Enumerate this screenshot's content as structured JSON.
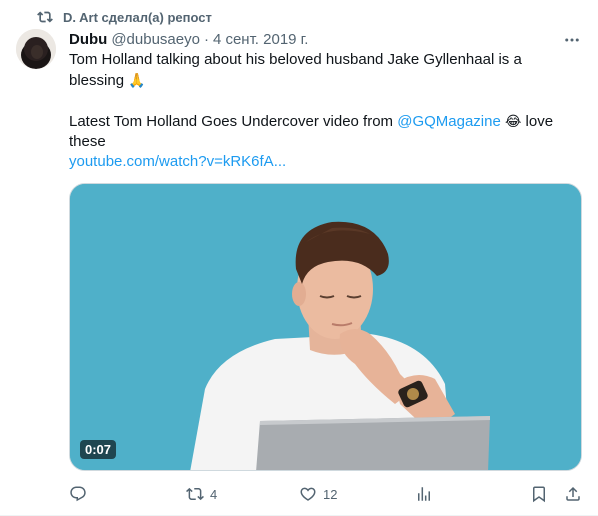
{
  "repost": {
    "label": "D. Art сделал(а) репост",
    "icon": "repost-icon"
  },
  "author": {
    "name": "Dubu",
    "handle": "@dubusaeyo",
    "separator": "·",
    "date": "4 сент. 2019 г."
  },
  "tweet": {
    "line1": "Tom Holland talking about his beloved husband Jake Gyllenhaal is a blessing",
    "line1_emoji": "🙏",
    "line2_prefix": "Latest Tom Holland Goes Undercover video from ",
    "mention": "@GQMagazine",
    "line2_emoji": "😂",
    "line2_suffix": " love these",
    "url": "youtube.com/watch?v=kRK6fA..."
  },
  "media": {
    "duration": "0:07"
  },
  "actions": {
    "reply": {
      "icon": "reply-icon",
      "count": ""
    },
    "retweet": {
      "icon": "retweet-icon",
      "count": "4"
    },
    "like": {
      "icon": "heart-icon",
      "count": "12"
    },
    "views": {
      "icon": "views-icon",
      "count": ""
    },
    "bookmark": {
      "icon": "bookmark-icon"
    },
    "share": {
      "icon": "share-icon"
    }
  },
  "colors": {
    "accent": "#1d9bf0",
    "muted": "#536471",
    "video_bg": "#4fb0c9"
  }
}
